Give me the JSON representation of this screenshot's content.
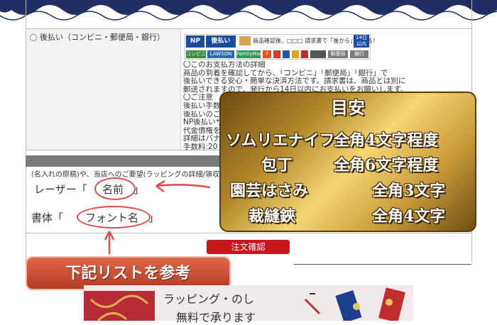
{
  "payment": {
    "option_label": "後払い（コンビニ・郵便局・銀行）",
    "banner": {
      "logo": "NP",
      "tag": "後払い",
      "text": "商品確認後、□□□ 請求書で「後から」払える！",
      "days": "14日以内",
      "stores": [
        "コンビニ",
        "LAWSON",
        "FamilyMart",
        "7",
        "",
        "",
        "",
        "",
        "",
        "郵便局",
        "銀行"
      ]
    },
    "details": [
      "〇このお支払方法の詳細",
      "商品の到着を確認してから、「コンビニ」「郵便局」「銀行」で",
      "後払いできる安心・簡単な決済方法です。請求書は、商品とは別に",
      "郵送されますので、発行から14日以内にお支払いをお願いします。",
      "〇ご注意",
      "後払い手数",
      "後払いのご",
      "NP後払いサ",
      "代金債権を",
      "詳細はバナ",
      "手数料:20"
    ]
  },
  "comment": {
    "hint": "（名入れの原稿)や、当店へのご要望(ラッピングの詳細/領収",
    "laser_label": "レーザー「",
    "laser_value": "名前",
    "laser_close": "」",
    "font_label": "書体「",
    "font_value": "フォント名",
    "font_close": "」"
  },
  "confirm_button": "注文確認",
  "list_banner": "下記リストを参考",
  "guide": {
    "title": "目安",
    "rows": [
      {
        "item": "ソムリエナイフ",
        "length": "全角4文字程度"
      },
      {
        "item": "包丁",
        "length": "全角6文字程度"
      },
      {
        "item": "園芸はさみ",
        "length": "全角3文字"
      },
      {
        "item": "裁縫鋏",
        "length": "全角4文字"
      }
    ]
  },
  "wrapping": {
    "line1": "ラッピング・のし",
    "line2": "無料で承ります"
  },
  "colors": {
    "accent_red": "#c8161d",
    "annotation_red": "#e24b4b",
    "gold": "#c99a38"
  }
}
